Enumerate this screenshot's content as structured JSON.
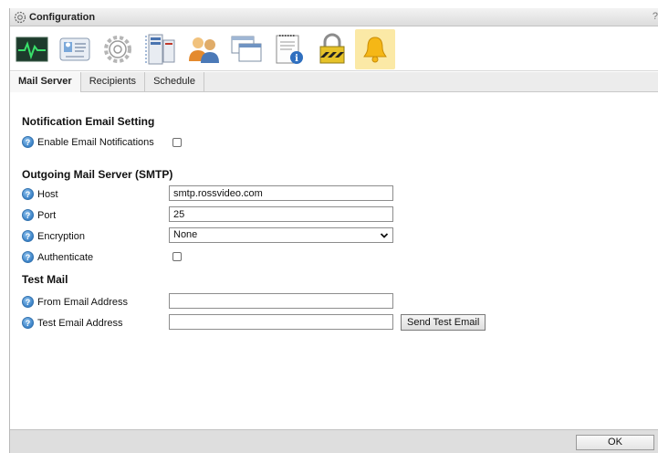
{
  "window": {
    "title": "Configuration",
    "close_glyph": "?"
  },
  "toolbar": {
    "icons": [
      {
        "name": "monitoring-icon"
      },
      {
        "name": "device-info-icon"
      },
      {
        "name": "settings-gear-icon"
      },
      {
        "name": "network-icon"
      },
      {
        "name": "users-icon"
      },
      {
        "name": "windows-icon"
      },
      {
        "name": "notes-info-icon"
      },
      {
        "name": "security-lock-icon"
      },
      {
        "name": "notification-bell-icon",
        "active": true
      }
    ]
  },
  "tabs": [
    {
      "label": "Mail Server",
      "active": true
    },
    {
      "label": "Recipients"
    },
    {
      "label": "Schedule"
    }
  ],
  "notification": {
    "section_title": "Notification Email Setting",
    "enable_label": "Enable Email Notifications",
    "enable_checked": false
  },
  "smtp": {
    "section_title": "Outgoing Mail Server (SMTP)",
    "host_label": "Host",
    "host_value": "smtp.rossvideo.com",
    "port_label": "Port",
    "port_value": "25",
    "encryption_label": "Encryption",
    "encryption_value": "None",
    "authenticate_label": "Authenticate",
    "authenticate_checked": false
  },
  "test_mail": {
    "section_title": "Test Mail",
    "from_label": "From Email Address",
    "from_value": "",
    "to_label": "Test Email Address",
    "to_value": "",
    "send_button": "Send Test Email"
  },
  "footer": {
    "ok_label": "OK"
  },
  "colors": {
    "active_icon_bg": "#fbe9a6",
    "help_icon": "#3b82c7"
  }
}
